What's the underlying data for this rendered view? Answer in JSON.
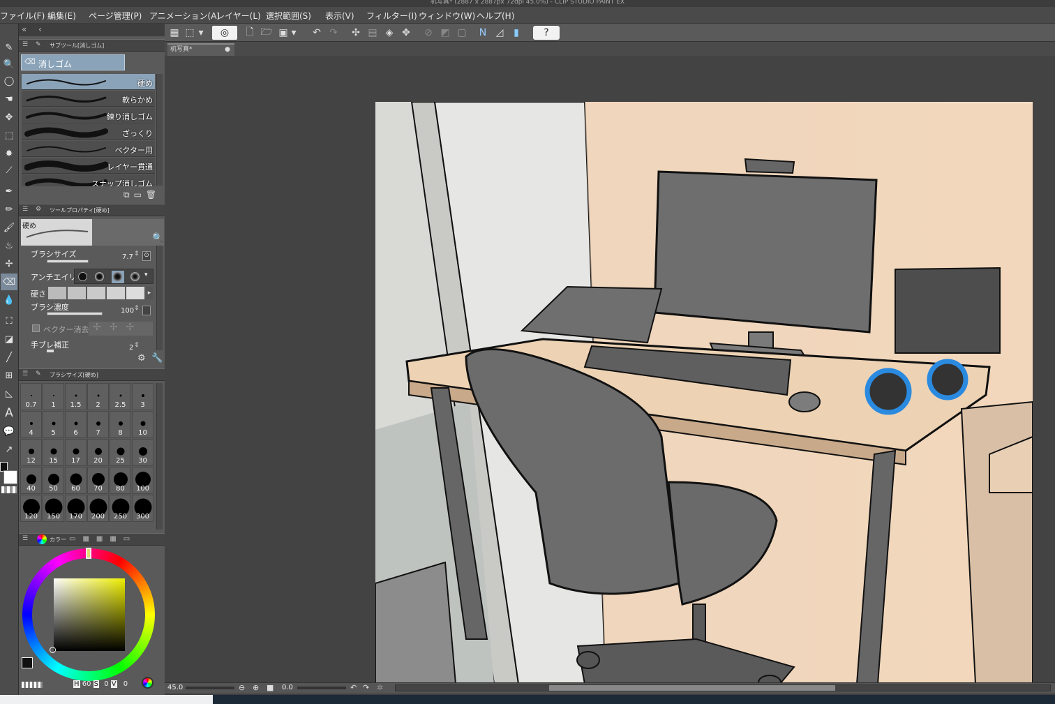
{
  "window": {
    "title": "机写真* (2887 x 2887px 72dpi 45.0%) - CLIP STUDIO PAINT EX"
  },
  "menu": [
    "ファイル(F)",
    "編集(E)",
    "ページ管理(P)",
    "アニメーション(A)",
    "レイヤー(L)",
    "選択範囲(S)",
    "表示(V)",
    "フィルター(I)",
    "ウィンドウ(W)",
    "ヘルプ(H)"
  ],
  "subtool_palette": {
    "title": "サブツール[消しゴム]",
    "group": "消しゴム",
    "brushes": [
      {
        "label": "硬め",
        "selected": true
      },
      {
        "label": "軟らかめ"
      },
      {
        "label": "練り消しゴム"
      },
      {
        "label": "ざっくり"
      },
      {
        "label": "ベクター用"
      },
      {
        "label": "レイヤー貫通"
      },
      {
        "label": "スナップ消しゴム"
      }
    ]
  },
  "tool_property": {
    "title": "ツールプロパティ[硬め]",
    "preset": "硬め",
    "brush_size_label": "ブラシサイズ",
    "brush_size_value": "7.7",
    "antialias_label": "アンチエイリアス",
    "hardness_label": "硬さ",
    "density_label": "ブラシ濃度",
    "density_value": "100",
    "vector_erase_label": "ベクター消去",
    "stabilization_label": "手ブレ補正",
    "stabilization_value": "2"
  },
  "brush_size_palette": {
    "title": "ブラシサイズ[硬め]",
    "sizes": [
      "0.7",
      "1",
      "1.5",
      "2",
      "2.5",
      "3",
      "4",
      "5",
      "6",
      "7",
      "8",
      "10",
      "12",
      "15",
      "17",
      "20",
      "25",
      "30",
      "40",
      "50",
      "60",
      "70",
      "80",
      "100",
      "120",
      "150",
      "170",
      "200",
      "250",
      "300"
    ]
  },
  "color_palette": {
    "title": "カラー",
    "h_label": "H",
    "h_value": "60",
    "s_label": "S",
    "s_value": "0",
    "v_label": "V",
    "v_value": "0"
  },
  "canvas": {
    "tab_label": "机写真*"
  },
  "status": {
    "zoom": "45.0",
    "angle": "0.0"
  },
  "colors": {
    "accent_selected": "#8aa3b8",
    "panel_bg": "#5a5a5a",
    "canvas_bg": "#434343"
  }
}
